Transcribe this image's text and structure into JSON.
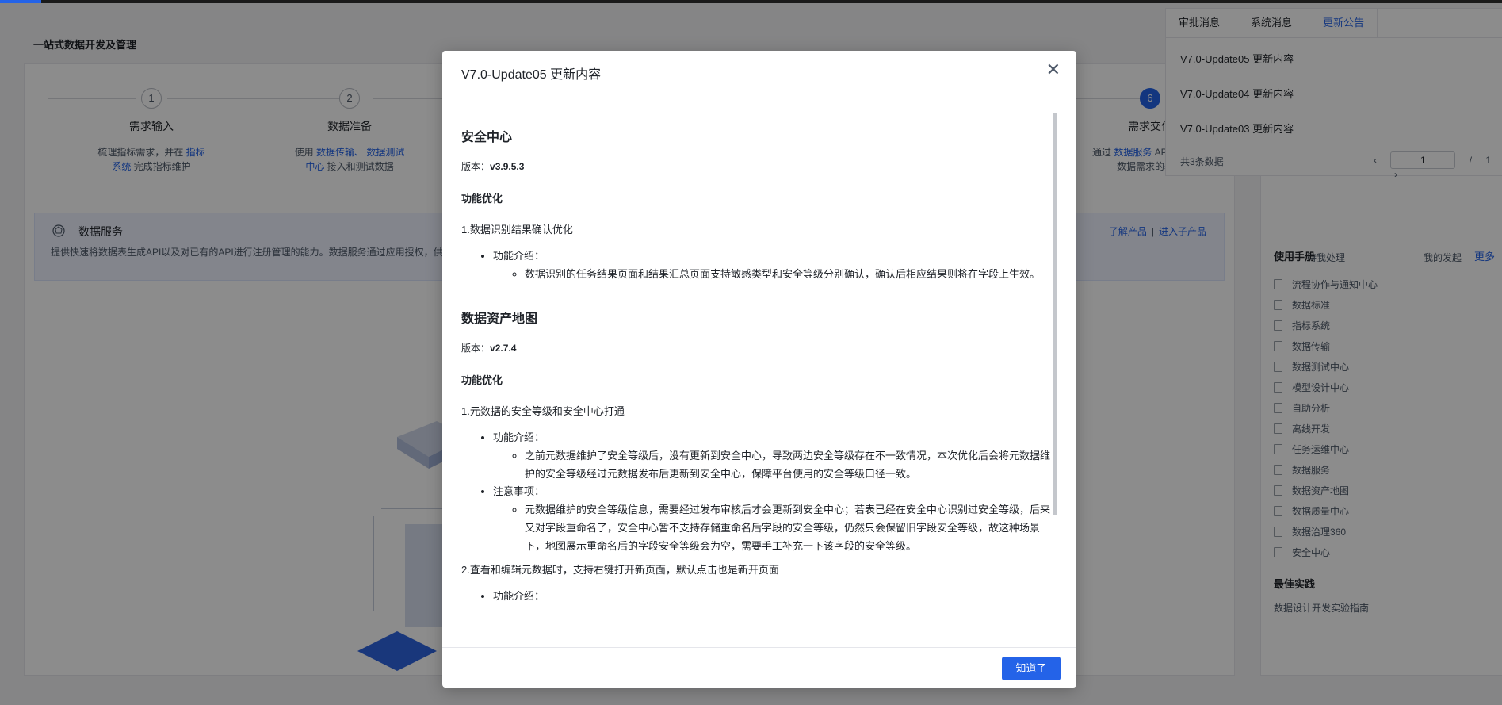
{
  "page": {
    "title": "一站式数据开发及管理",
    "steps": [
      {
        "num": "1",
        "name": "需求输入",
        "desc_pre": "梳理指标需求，并在 ",
        "desc_link": "指标系统",
        "desc_post": " 完成指标维护"
      },
      {
        "num": "2",
        "name": "数据准备",
        "desc_pre": "使用 ",
        "desc_link": "数据传输、 数据测试中心",
        "desc_post": " 接入和测试数据"
      },
      {
        "num": "6",
        "name": "需求交付",
        "desc_pre": "通过 ",
        "desc_link": "数据服务",
        "desc_post": " API完成最终数据需求的输出"
      }
    ],
    "service": {
      "title": "数据服务",
      "desc": "提供快速将数据表生成API以及对已有的API进行注册管理的能力。数据服务通过应用授权，供",
      "link_learn": "了解产品",
      "link_sep": "|",
      "link_enter": "进入子产品"
    }
  },
  "side": {
    "stats": [
      {
        "label": "待我处理"
      },
      {
        "label": "我的发起"
      }
    ],
    "manual_title": "使用手册",
    "manual_more": "更多",
    "manual_items": [
      "流程协作与通知中心",
      "数据标准",
      "指标系统",
      "数据传输",
      "数据测试中心",
      "模型设计中心",
      "自助分析",
      "离线开发",
      "任务运维中心",
      "数据服务",
      "数据资产地图",
      "数据质量中心",
      "数据治理360",
      "安全中心"
    ],
    "best_title": "最佳实践",
    "best_item": "数据设计开发实验指南"
  },
  "notifications": {
    "tabs": [
      "审批消息",
      "系统消息",
      "更新公告"
    ],
    "active_tab": "更新公告",
    "items": [
      "V7.0-Update05 更新内容",
      "V7.0-Update04 更新内容",
      "V7.0-Update03 更新内容"
    ],
    "total": "共3条数据",
    "page_current": "1",
    "page_sep": "/",
    "page_total": "1"
  },
  "modal": {
    "title": "V7.0-Update05 更新内容",
    "ok_label": "知道了",
    "sections": [
      {
        "title": "安全中心",
        "version_label": "版本：",
        "version": "v3.9.5.3",
        "feature_label": "功能优化",
        "item1": "1.数据识别结果确认优化",
        "intro_label": "功能介绍：",
        "intro_text": "数据识别的任务结果页面和结果汇总页面支持敏感类型和安全等级分别确认，确认后相应结果则将在字段上生效。"
      },
      {
        "title": "数据资产地图",
        "version_label": "版本：",
        "version": "v2.7.4",
        "feature_label": "功能优化",
        "item1": "1.元数据的安全等级和安全中心打通",
        "intro_label": "功能介绍：",
        "intro_text": "之前元数据维护了安全等级后，没有更新到安全中心，导致两边安全等级存在不一致情况，本次优化后会将元数据维护的安全等级经过元数据发布后更新到安全中心，保障平台使用的安全等级口径一致。",
        "note_label": "注意事项：",
        "note_text": "元数据维护的安全等级信息，需要经过发布审核后才会更新到安全中心；若表已经在安全中心识别过安全等级，后来又对字段重命名了，安全中心暂不支持存储重命名后字段的安全等级，仍然只会保留旧字段安全等级，故这种场景下，地图展示重命名后的字段安全等级会为空，需要手工补充一下该字段的安全等级。",
        "item2": "2.查看和编辑元数据时，支持右键打开新页面，默认点击也是新开页面",
        "intro2_label": "功能介绍："
      }
    ]
  },
  "colors": {
    "accent": "#2463e8",
    "overlay": "rgba(0,0,0,0.45)"
  }
}
